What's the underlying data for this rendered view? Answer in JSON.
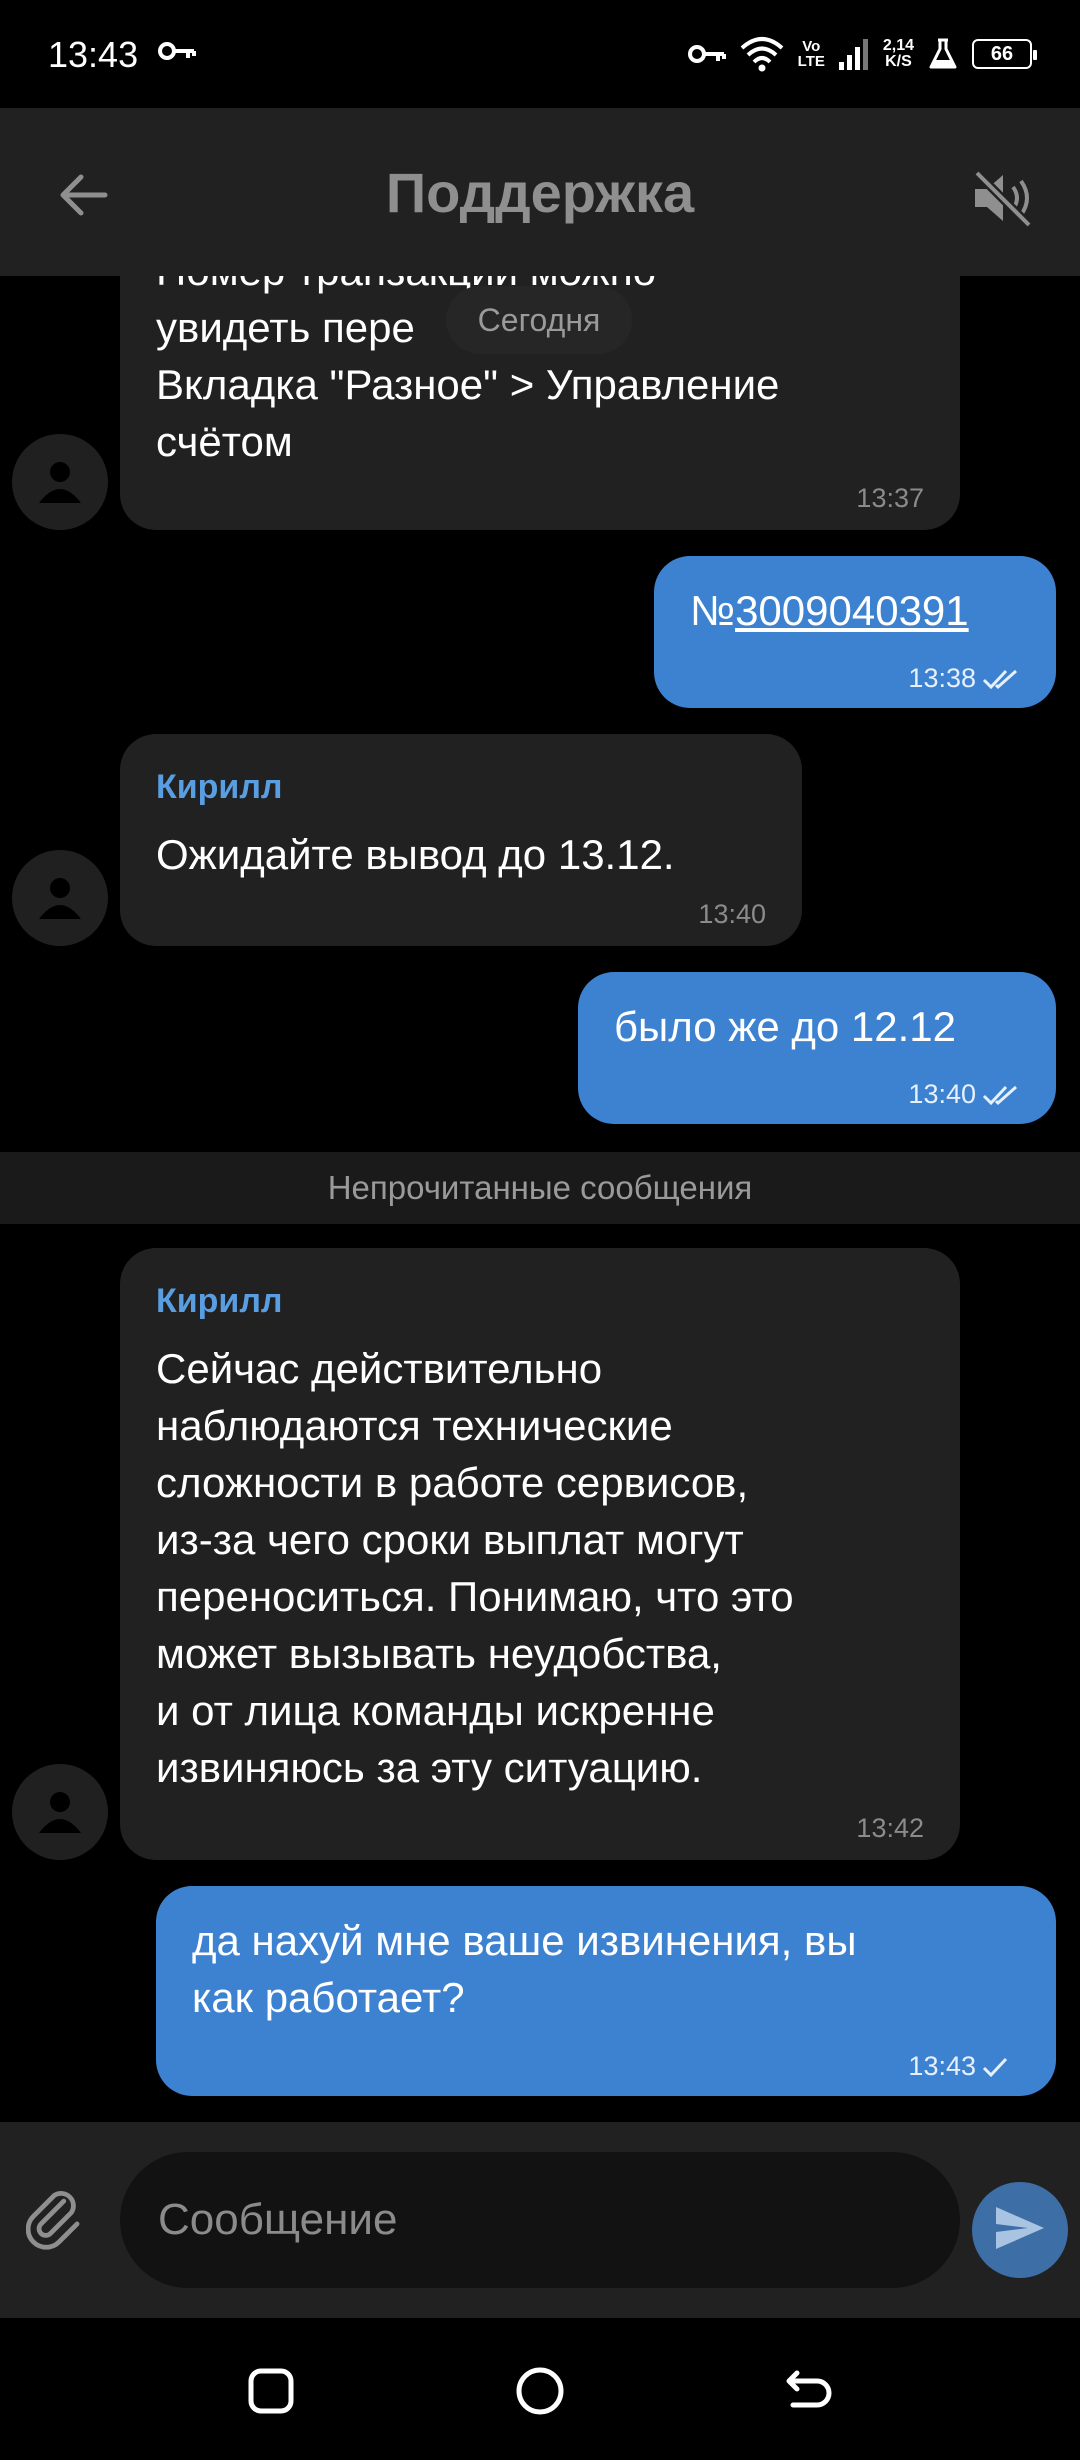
{
  "status_bar": {
    "time": "13:43",
    "network_type_top": "Vo",
    "network_type_bottom": "LTE",
    "speed_value": "2,14",
    "speed_unit": "K/S",
    "battery": "66",
    "icons": [
      "key-icon",
      "vpn-key-icon",
      "wifi-icon",
      "signal-icon",
      "flask-icon",
      "battery-icon"
    ]
  },
  "header": {
    "title": "Поддержка",
    "back_icon": "arrow-left-icon",
    "mute_icon": "speaker-muted-icon"
  },
  "chat": {
    "date_separator": "Сегодня",
    "unread_separator": "Непрочитанные сообщения",
    "messages": [
      {
        "direction": "in",
        "text": "Номер транзакции можно\nувидеть пере     еню >\nВкладка \"Разное\" > Управление\nсчётом",
        "time": "13:37"
      },
      {
        "direction": "out",
        "prefix": "№",
        "link": "3009040391",
        "time": "13:38",
        "status": "read"
      },
      {
        "direction": "in",
        "sender": "Кирилл",
        "text": "Ожидайте вывод до 13.12.",
        "time": "13:40"
      },
      {
        "direction": "out",
        "text": "было же до 12.12",
        "time": "13:40",
        "status": "read"
      },
      {
        "direction": "in",
        "sender": "Кирилл",
        "text": "Сейчас действительно\nнаблюдаются технические\nсложности в работе сервисов,\nиз-за чего сроки выплат могут\nпереноситься. Понимаю, что это\nможет вызывать неудобства,\nи от лица команды искренне\nизвиняюсь за эту ситуацию.",
        "time": "13:42"
      },
      {
        "direction": "out",
        "text": "да нахуй мне ваше извинения, вы\nкак работает?",
        "time": "13:43",
        "status": "sent"
      }
    ]
  },
  "input_bar": {
    "placeholder": "Сообщение",
    "value": "",
    "attach_icon": "paperclip-icon",
    "send_icon": "send-icon"
  },
  "nav_bar": {
    "icons": [
      "recent-apps-icon",
      "home-icon",
      "back-icon"
    ]
  },
  "colors": {
    "header_bg": "#212121",
    "incoming_bubble": "#212121",
    "outgoing_bubble": "#3d82d1",
    "sender_name": "#5a9ee2",
    "send_button": "#3d6ea5"
  }
}
